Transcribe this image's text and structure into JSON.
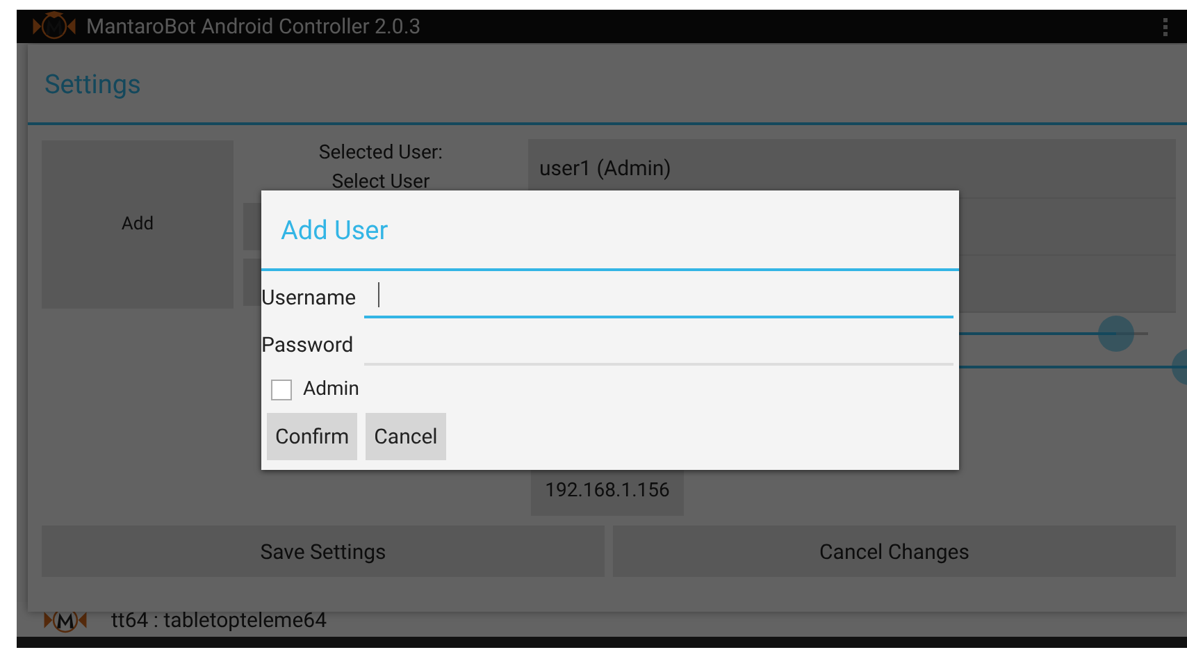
{
  "app_bar": {
    "title": "MantaroBot Android Controller 2.0.3"
  },
  "settings": {
    "title": "Settings",
    "add_button": "Add",
    "selected_user_label": "Selected User:",
    "select_user_label": "Select User",
    "user_field": {
      "value": "user1 (Admin)"
    },
    "sliders": [
      {
        "level": 0.96
      },
      {
        "level": 1.0
      }
    ],
    "ip_button": "192.168.1.156",
    "buttons": [
      "Save Settings",
      "Cancel Changes"
    ]
  },
  "status_bar": {
    "text": "tt64 : tabletopteleme64"
  },
  "dialog": {
    "title": "Add User",
    "fields": [
      {
        "label": "Username",
        "focused": true
      },
      {
        "label": "Password",
        "focused": false
      }
    ],
    "admin_checkbox": {
      "label": "Admin",
      "checked": false
    },
    "buttons": [
      "Confirm",
      "Cancel"
    ]
  }
}
